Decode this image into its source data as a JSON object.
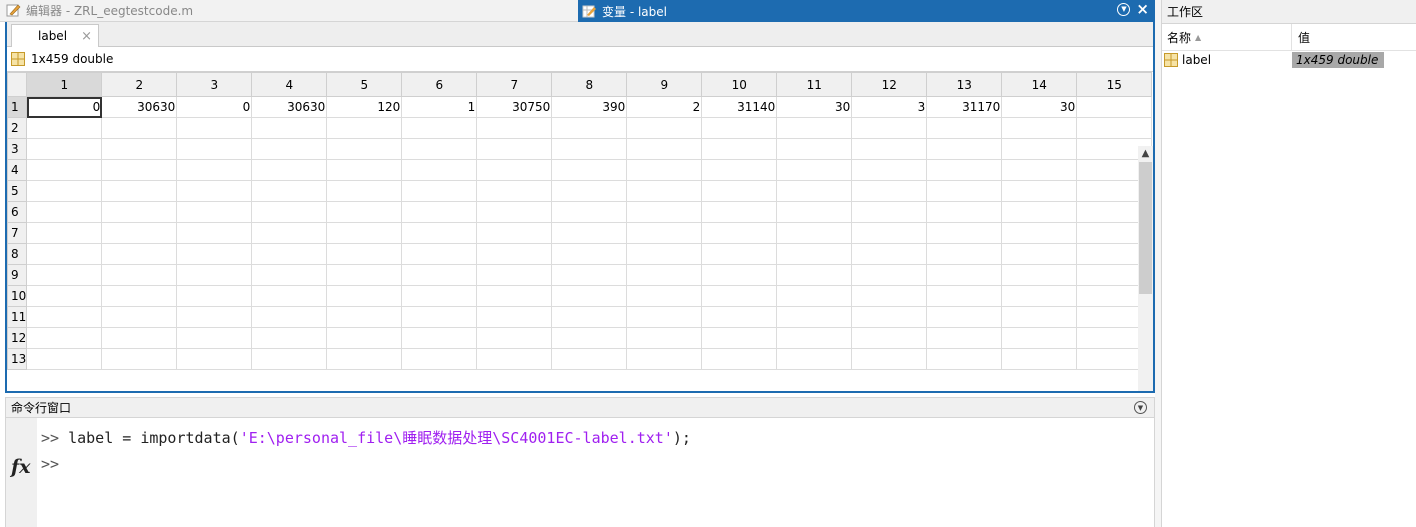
{
  "editor_tab": {
    "title": "编辑器 - ZRL_eegtestcode.m"
  },
  "variables_panel": {
    "title": "变量 - label",
    "doc_tab": "label",
    "size_label": "1x459 double",
    "column_headers": [
      "1",
      "2",
      "3",
      "4",
      "5",
      "6",
      "7",
      "8",
      "9",
      "10",
      "11",
      "12",
      "13",
      "14",
      "15"
    ],
    "row_headers": [
      "1",
      "2",
      "3",
      "4",
      "5",
      "6",
      "7",
      "8",
      "9",
      "10",
      "11",
      "12",
      "13"
    ],
    "row1_values": [
      "0",
      "30630",
      "0",
      "30630",
      "120",
      "1",
      "30750",
      "390",
      "2",
      "31140",
      "30",
      "3",
      "31170",
      "30",
      ""
    ]
  },
  "command_window": {
    "title": "命令行窗口",
    "prompt": ">>",
    "line1_code": " label = importdata(",
    "line1_string": "'E:\\personal_file\\睡眠数据处理\\SC4001EC-label.txt'",
    "line1_tail": ");",
    "fx_label": "fx"
  },
  "workspace": {
    "title": "工作区",
    "col_name": "名称",
    "col_value": "值",
    "variables": [
      {
        "name": "label",
        "value": "1x459 double"
      }
    ]
  },
  "colors": {
    "accent": "#1d6bb0",
    "string_literal": "#a020f0",
    "header_bg": "#f0f0f0"
  }
}
